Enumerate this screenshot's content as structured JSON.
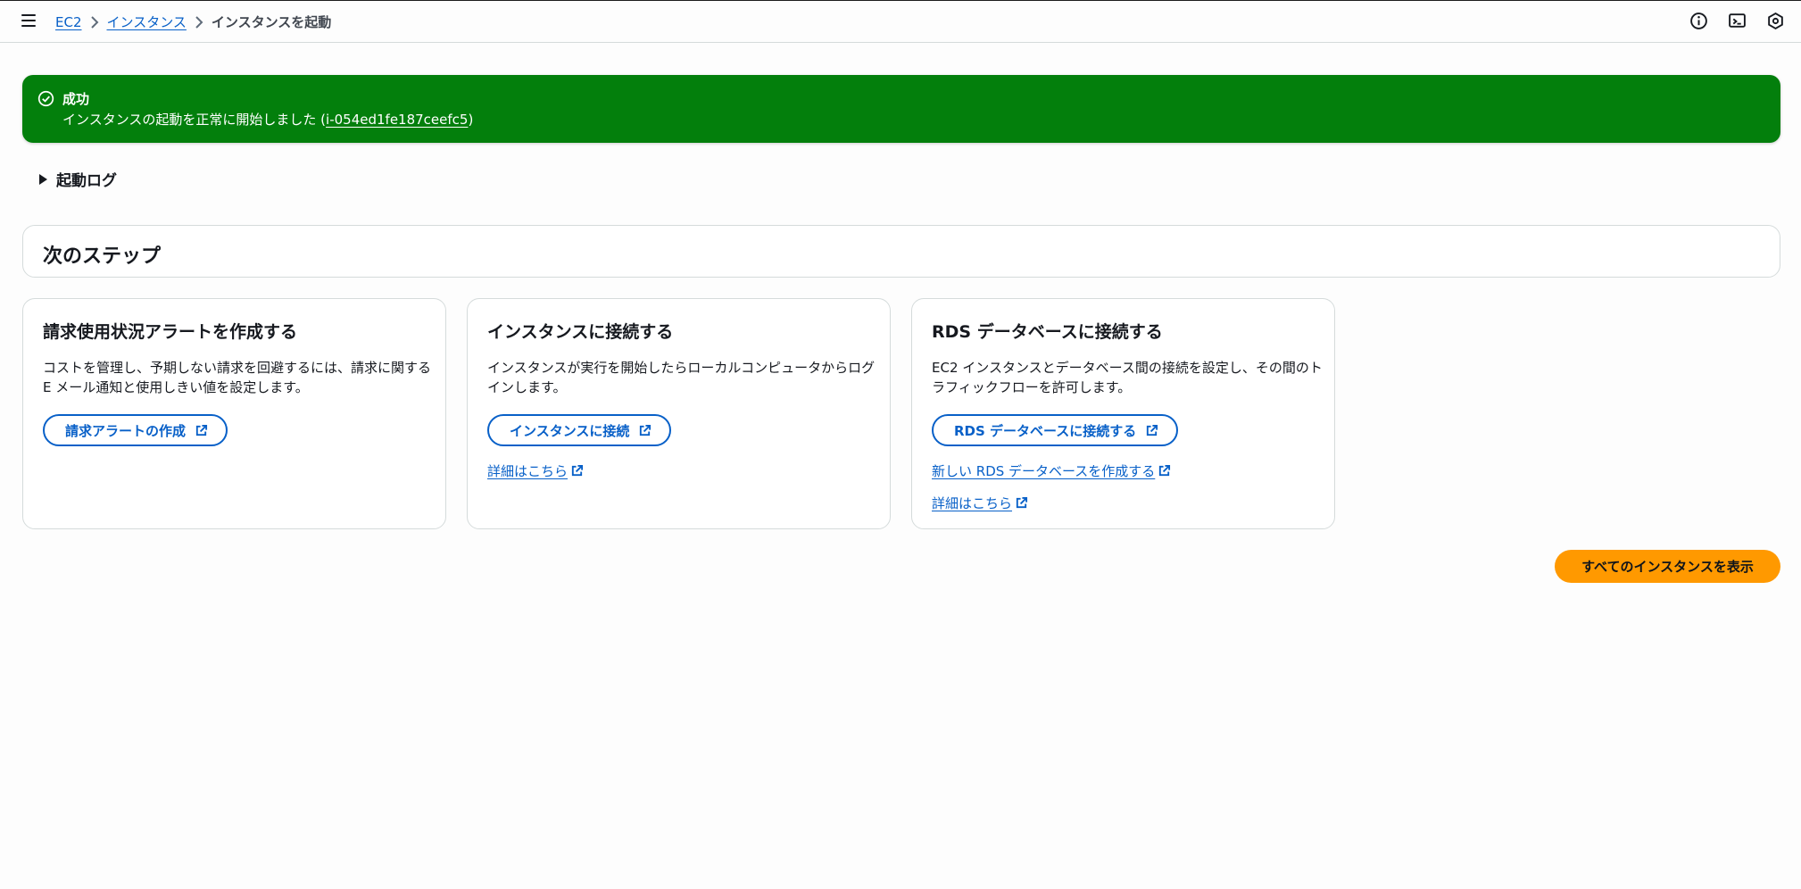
{
  "breadcrumb": {
    "items": [
      "EC2",
      "インスタンス"
    ],
    "current": "インスタンスを起動"
  },
  "top_icons": [
    "info-icon",
    "cloudshell-icon",
    "settings-shield-icon"
  ],
  "flash": {
    "title": "成功",
    "message_prefix": "インスタンスの起動を正常に開始しました (",
    "instance_id": "i-054ed1fe187ceefc5",
    "message_suffix": ")",
    "color": "#037f0c"
  },
  "launch_log": {
    "label": "起動ログ"
  },
  "next_steps": {
    "title": "次のステップ"
  },
  "cards": [
    {
      "title": "請求使用状況アラートを作成する",
      "description": "コストを管理し、予期しない請求を回避するには、請求に関する E メール通知と使用しきい値を設定します。",
      "button": "請求アラートの作成",
      "links": []
    },
    {
      "title": "インスタンスに接続する",
      "description": "インスタンスが実行を開始したらローカルコンピュータからログインします。",
      "button": "インスタンスに接続",
      "links": [
        "詳細はこちら"
      ]
    },
    {
      "title": "RDS データベースに接続する",
      "description": "EC2 インスタンスとデータベース間の接続を設定し、その間のトラフィックフローを許可します。",
      "button": "RDS データベースに接続する",
      "links": [
        "新しい RDS データベースを作成する",
        "詳細はこちら"
      ]
    }
  ],
  "view_all": {
    "label": "すべてのインスタンスを表示",
    "color": "#ff9900"
  },
  "accent_color": "#0860c8"
}
